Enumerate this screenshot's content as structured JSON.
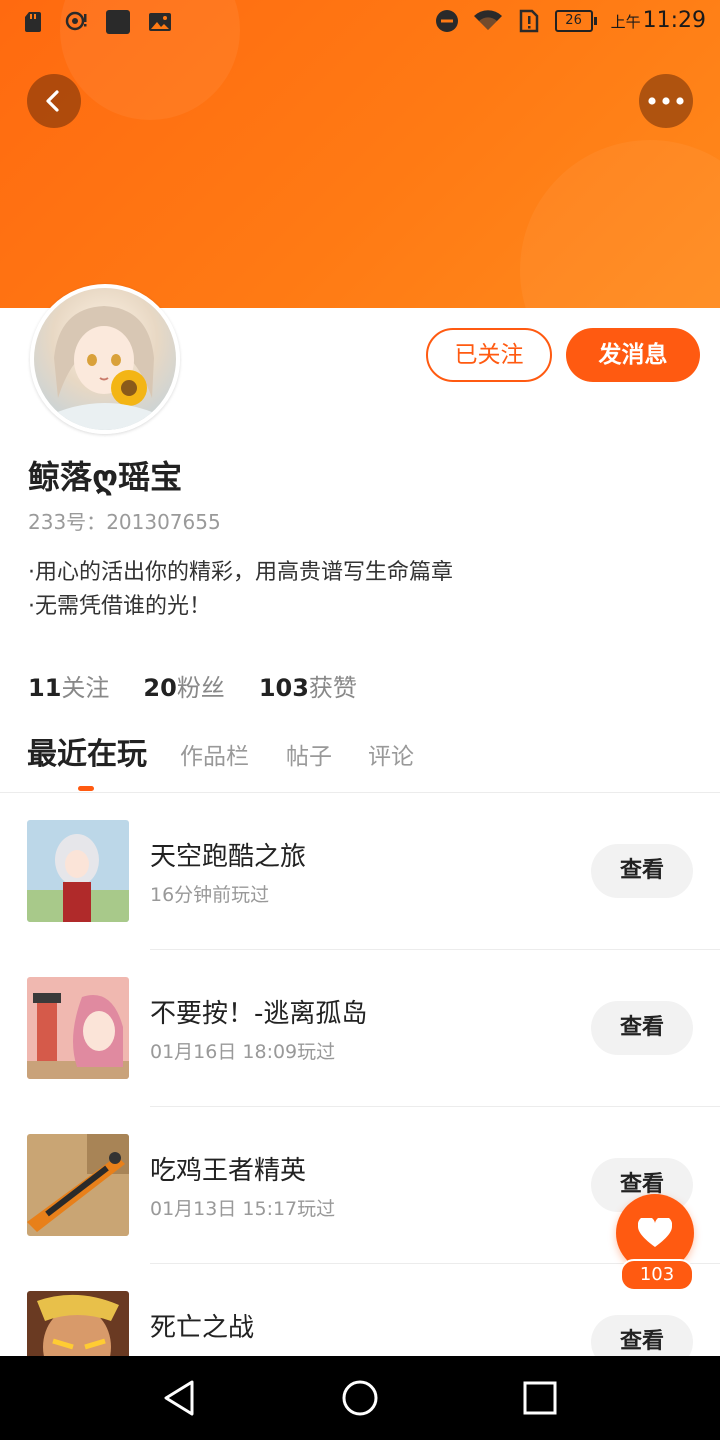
{
  "status_bar": {
    "battery_level": "26",
    "time_prefix": "上午",
    "time": "11:29",
    "icons": [
      "sd-card-icon",
      "sync-icon",
      "app-icon",
      "image-icon",
      "dnd-icon",
      "wifi-icon",
      "alert-icon",
      "battery-icon"
    ]
  },
  "header": {
    "back_icon": "chevron-left-icon",
    "more_icon": "more-dots-icon",
    "banner_color": "#ff7a14"
  },
  "profile": {
    "username": "鲸落ღ瑶宝",
    "id_label": "233号：",
    "id_value": "201307655",
    "bio": [
      "·用心的活出你的精彩，用高贵谱写生命篇章",
      "·无需凭借谁的光！"
    ],
    "follow_button": "已关注",
    "message_button": "发消息"
  },
  "stats": [
    {
      "value": "11",
      "label": "关注"
    },
    {
      "value": "20",
      "label": "粉丝"
    },
    {
      "value": "103",
      "label": "获赞"
    }
  ],
  "tabs": [
    "最近在玩",
    "作品栏",
    "帖子",
    "评论"
  ],
  "active_tab": "最近在玩",
  "recent_games": [
    {
      "name": "天空跑酷之旅",
      "time": "16分钟前玩过",
      "button": "查看"
    },
    {
      "name": "不要按！-逃离孤岛",
      "time": "01月16日 18:09玩过",
      "button": "查看"
    },
    {
      "name": "吃鸡王者精英",
      "time": "01月13日 15:17玩过",
      "button": "查看"
    },
    {
      "name": "死亡之战",
      "time": "",
      "button": "查看"
    }
  ],
  "like_fab": {
    "icon": "heart-icon",
    "count": "103"
  },
  "colors": {
    "accent": "#ff5a11",
    "muted_text": "#999999",
    "text": "#222222"
  },
  "system_nav": [
    "back-triangle-icon",
    "home-circle-icon",
    "recents-square-icon"
  ]
}
